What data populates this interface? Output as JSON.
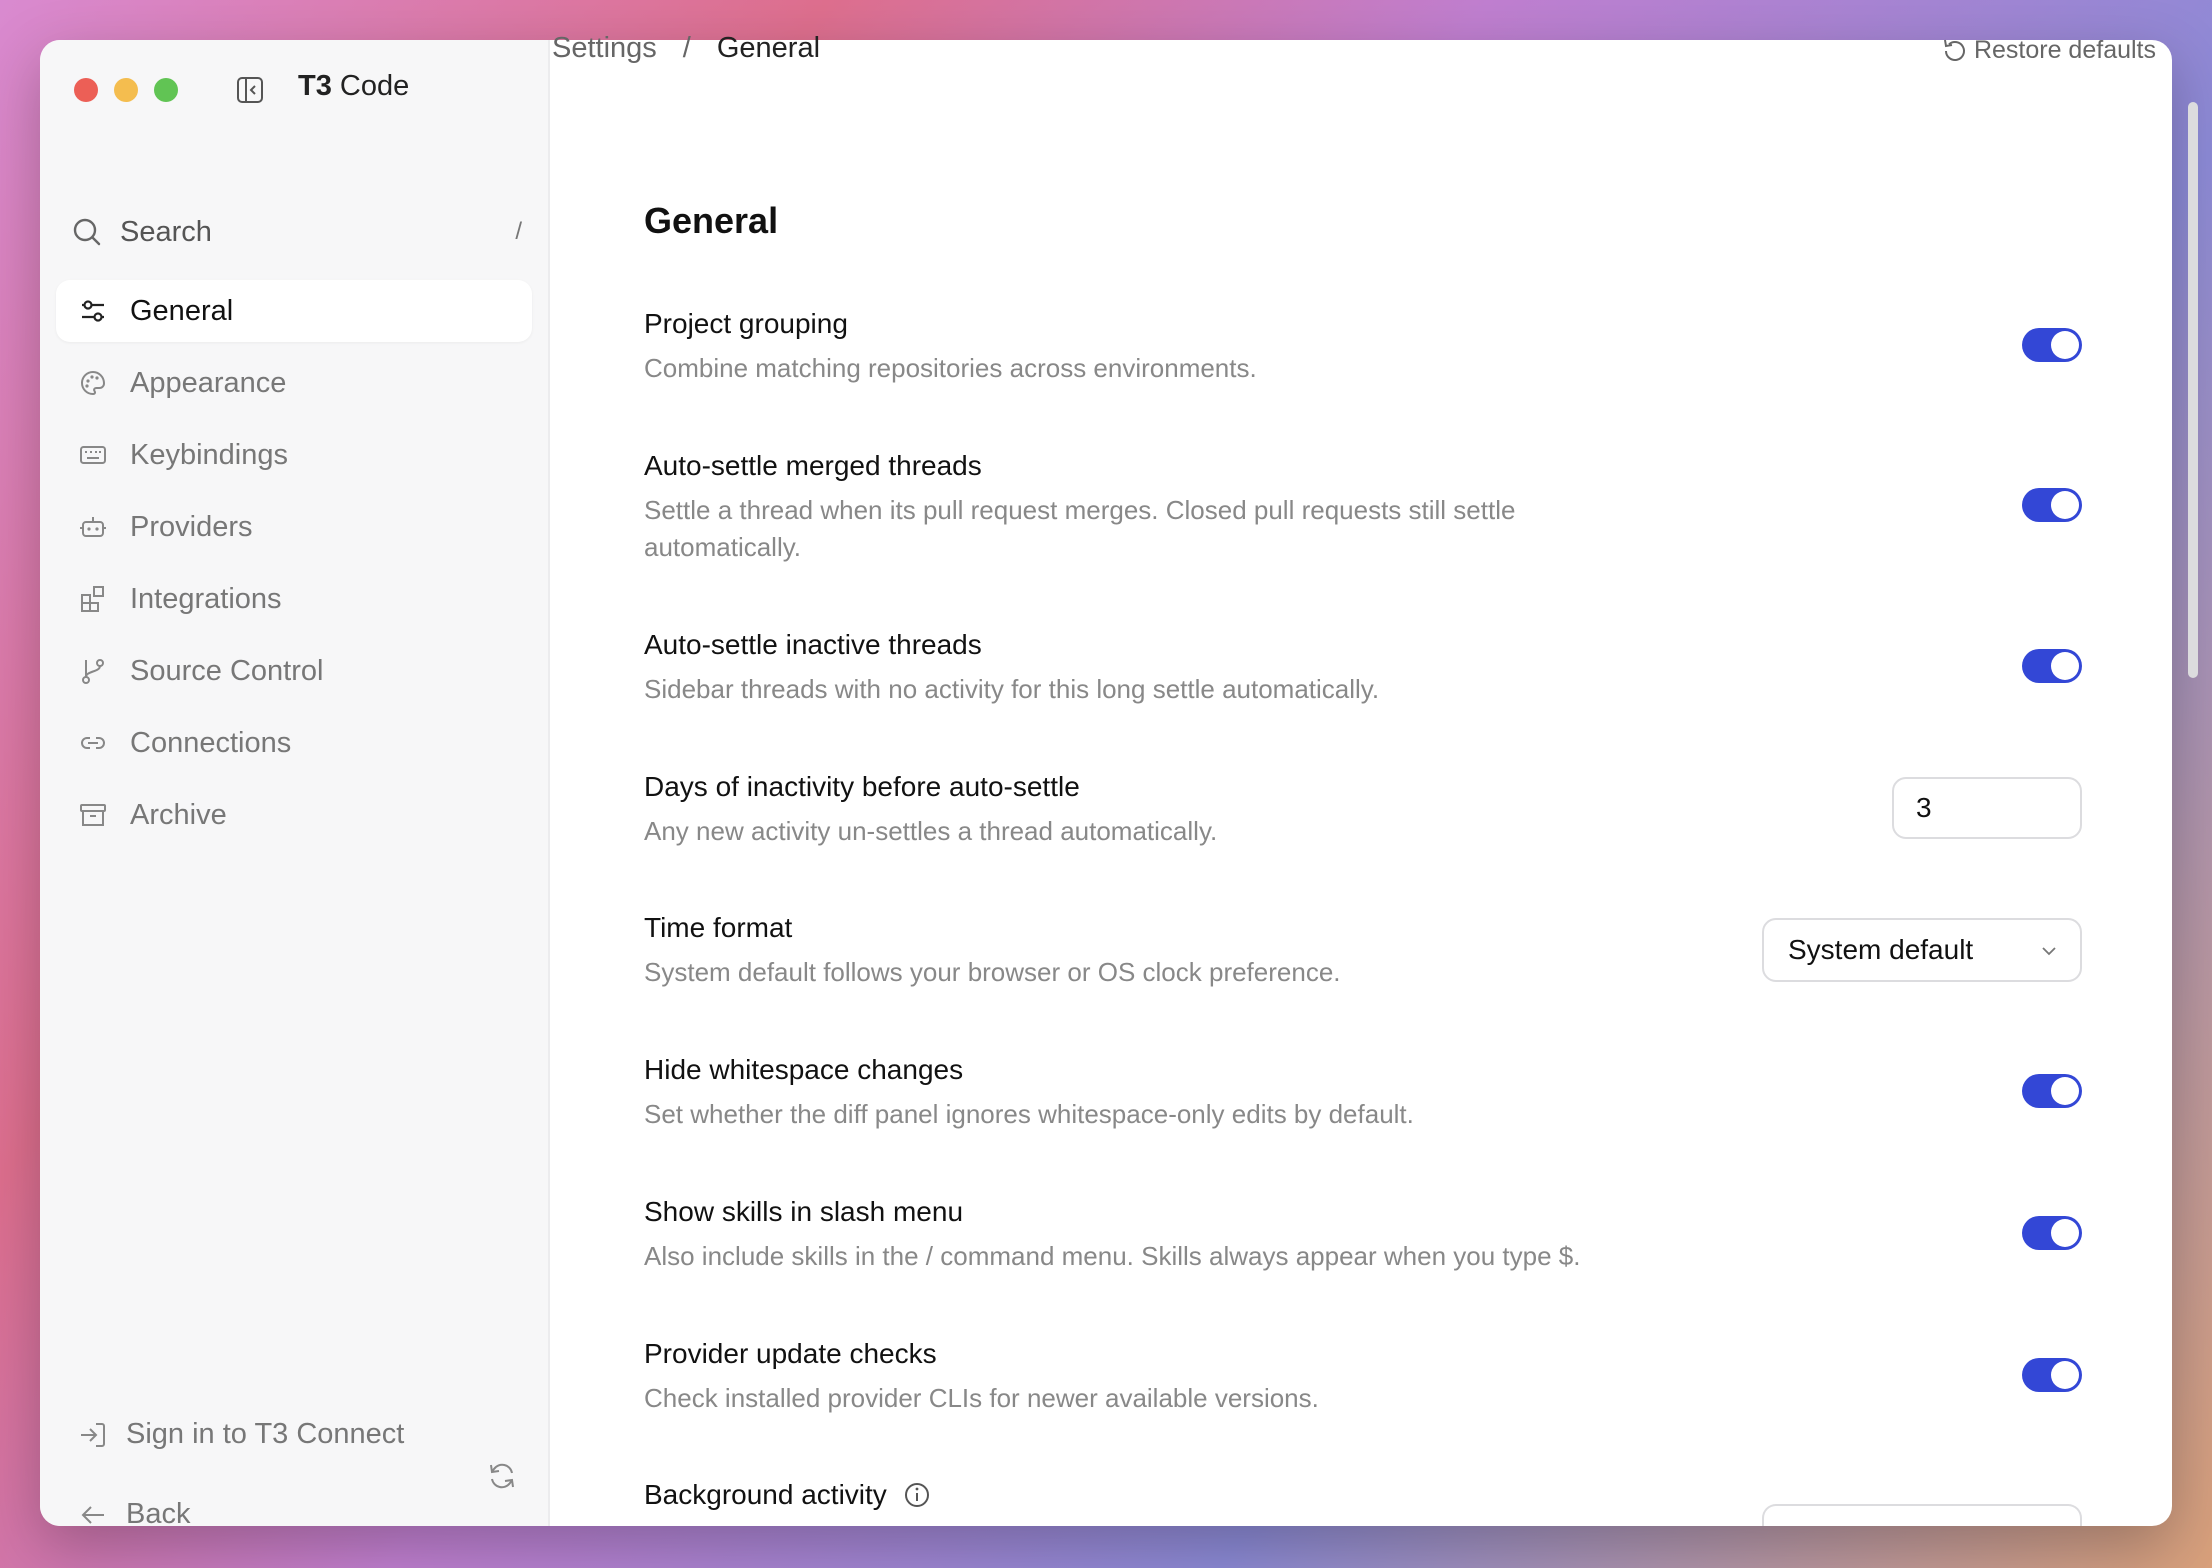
{
  "app": {
    "title_bold": "T3",
    "title_rest": " Code"
  },
  "search": {
    "label": "Search",
    "shortcut": "/"
  },
  "nav": [
    {
      "label": "General",
      "icon": "sliders-icon",
      "active": true
    },
    {
      "label": "Appearance",
      "icon": "palette-icon"
    },
    {
      "label": "Keybindings",
      "icon": "keyboard-icon"
    },
    {
      "label": "Providers",
      "icon": "bot-icon"
    },
    {
      "label": "Integrations",
      "icon": "blocks-icon"
    },
    {
      "label": "Source Control",
      "icon": "git-branch-icon"
    },
    {
      "label": "Connections",
      "icon": "link-icon"
    },
    {
      "label": "Archive",
      "icon": "archive-icon"
    }
  ],
  "footer": {
    "sign_in": "Sign in to T3 Connect",
    "back": "Back"
  },
  "breadcrumb": {
    "parent": "Settings",
    "separator": "/",
    "current": "General"
  },
  "restore_label": "Restore defaults",
  "page_title": "General",
  "settings": [
    {
      "title": "Project grouping",
      "desc": "Combine matching repositories across environments.",
      "control": "toggle",
      "on": true
    },
    {
      "title": "Auto-settle merged threads",
      "desc": "Settle a thread when its pull request merges. Closed pull requests still settle automatically.",
      "control": "toggle",
      "on": true
    },
    {
      "title": "Auto-settle inactive threads",
      "desc": "Sidebar threads with no activity for this long settle automatically.",
      "control": "toggle",
      "on": true
    },
    {
      "title": "Days of inactivity before auto-settle",
      "desc": "Any new activity un-settles a thread automatically.",
      "control": "number",
      "value": "3"
    },
    {
      "title": "Time format",
      "desc": "System default follows your browser or OS clock preference.",
      "control": "select",
      "value": "System default"
    },
    {
      "title": "Hide whitespace changes",
      "desc": "Set whether the diff panel ignores whitespace-only edits by default.",
      "control": "toggle",
      "on": true
    },
    {
      "title": "Show skills in slash menu",
      "desc": "Also include skills in the / command menu. Skills always appear when you type $.",
      "control": "toggle",
      "on": true
    },
    {
      "title": "Provider update checks",
      "desc": "Check installed provider CLIs for newer available versions.",
      "control": "toggle",
      "on": true
    },
    {
      "title": "Background activity",
      "control": "select"
    }
  ],
  "colors": {
    "accent": "#3347d6",
    "close": "#ec5f56",
    "minimize": "#f4bd4f",
    "zoom": "#61c454"
  }
}
